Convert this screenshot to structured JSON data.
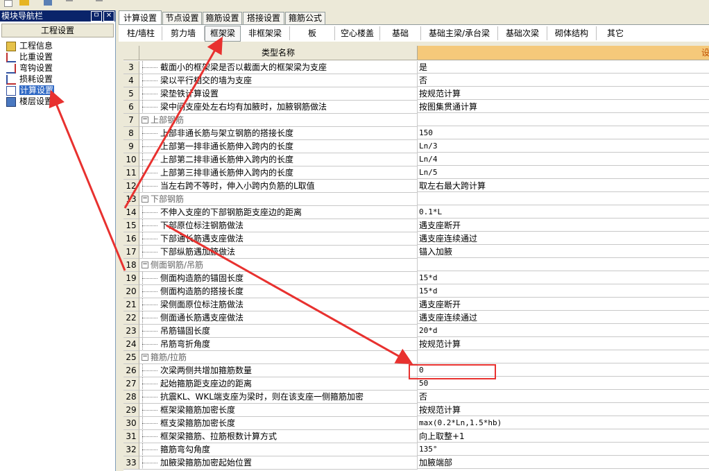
{
  "nav": {
    "title": "模块导航栏",
    "pin": "ㅁ",
    "close": "✕",
    "header": "工程设置",
    "items": [
      {
        "label": "工程信息",
        "icon": "folder-icon"
      },
      {
        "label": "比重设置",
        "icon": "weight-icon"
      },
      {
        "label": "弯钩设置",
        "icon": "hook-icon"
      },
      {
        "label": "损耗设置",
        "icon": "loss-icon"
      },
      {
        "label": "计算设置",
        "icon": "calc-icon",
        "selected": true
      },
      {
        "label": "楼层设置",
        "icon": "floor-icon"
      }
    ]
  },
  "tabs": [
    "计算设置",
    "节点设置",
    "箍筋设置",
    "搭接设置",
    "箍筋公式"
  ],
  "subtabs": [
    "柱/墙柱",
    "剪力墙",
    "框架梁",
    "非框架梁",
    "板",
    "空心楼盖",
    "基础",
    "基础主梁/承台梁",
    "基础次梁",
    "砌体结构",
    "其它"
  ],
  "grid": {
    "header_name": "类型名称",
    "header_value": "设置值",
    "rows": [
      {
        "num": "3",
        "name": "截面小的框架梁是否以截面大的框架梁为支座",
        "value": "是"
      },
      {
        "num": "4",
        "name": "梁以平行相交的墙为支座",
        "value": "否"
      },
      {
        "num": "5",
        "name": "梁垫铁计算设置",
        "value": "按规范计算"
      },
      {
        "num": "6",
        "name": "梁中间支座处左右均有加腋时，加腋钢筋做法",
        "value": "按图集贯通计算"
      },
      {
        "num": "7",
        "name": "上部钢筋",
        "value": "",
        "group": true
      },
      {
        "num": "8",
        "name": "上部非通长筋与架立钢筋的搭接长度",
        "value": "150"
      },
      {
        "num": "9",
        "name": "上部第一排非通长筋伸入跨内的长度",
        "value": "Ln/3"
      },
      {
        "num": "10",
        "name": "上部第二排非通长筋伸入跨内的长度",
        "value": "Ln/4"
      },
      {
        "num": "11",
        "name": "上部第三排非通长筋伸入跨内的长度",
        "value": "Ln/5"
      },
      {
        "num": "12",
        "name": "当左右跨不等时，伸入小跨内负筋的L取值",
        "value": "取左右最大跨计算"
      },
      {
        "num": "13",
        "name": "下部钢筋",
        "value": "",
        "group": true
      },
      {
        "num": "14",
        "name": "不伸入支座的下部钢筋距支座边的距离",
        "value": "0.1*L"
      },
      {
        "num": "15",
        "name": "下部原位标注钢筋做法",
        "value": "遇支座断开"
      },
      {
        "num": "16",
        "name": "下部通长筋遇支座做法",
        "value": "遇支座连续通过"
      },
      {
        "num": "17",
        "name": "下部纵筋遇加腋做法",
        "value": "锚入加腋"
      },
      {
        "num": "18",
        "name": "侧面钢筋/吊筋",
        "value": "",
        "group": true
      },
      {
        "num": "19",
        "name": "侧面构造筋的锚固长度",
        "value": "15*d"
      },
      {
        "num": "20",
        "name": "侧面构造筋的搭接长度",
        "value": "15*d"
      },
      {
        "num": "21",
        "name": "梁侧面原位标注筋做法",
        "value": "遇支座断开"
      },
      {
        "num": "22",
        "name": "侧面通长筋遇支座做法",
        "value": "遇支座连续通过"
      },
      {
        "num": "23",
        "name": "吊筋锚固长度",
        "value": "20*d"
      },
      {
        "num": "24",
        "name": "吊筋弯折角度",
        "value": "按规范计算"
      },
      {
        "num": "25",
        "name": "箍筋/拉筋",
        "value": "",
        "group": true
      },
      {
        "num": "26",
        "name": "次梁两侧共增加箍筋数量",
        "value": "0"
      },
      {
        "num": "27",
        "name": "起始箍筋距支座边的距离",
        "value": "50"
      },
      {
        "num": "28",
        "name": "抗震KL、WKL端支座为梁时，则在该支座一侧箍筋加密",
        "value": "否"
      },
      {
        "num": "29",
        "name": "框架梁箍筋加密长度",
        "value": "按规范计算"
      },
      {
        "num": "30",
        "name": "框支梁箍筋加密长度",
        "value": "max(0.2*Ln,1.5*hb)"
      },
      {
        "num": "31",
        "name": "框架梁箍筋、拉筋根数计算方式",
        "value": "向上取整+1"
      },
      {
        "num": "32",
        "name": "箍筋弯勾角度",
        "value": "135°"
      },
      {
        "num": "33",
        "name": "加腋梁箍筋加密起始位置",
        "value": "加腋端部"
      }
    ]
  },
  "colors": {
    "annotation": "#e8312f",
    "selection": "#316ac5",
    "value_header": "#f5c97a"
  }
}
